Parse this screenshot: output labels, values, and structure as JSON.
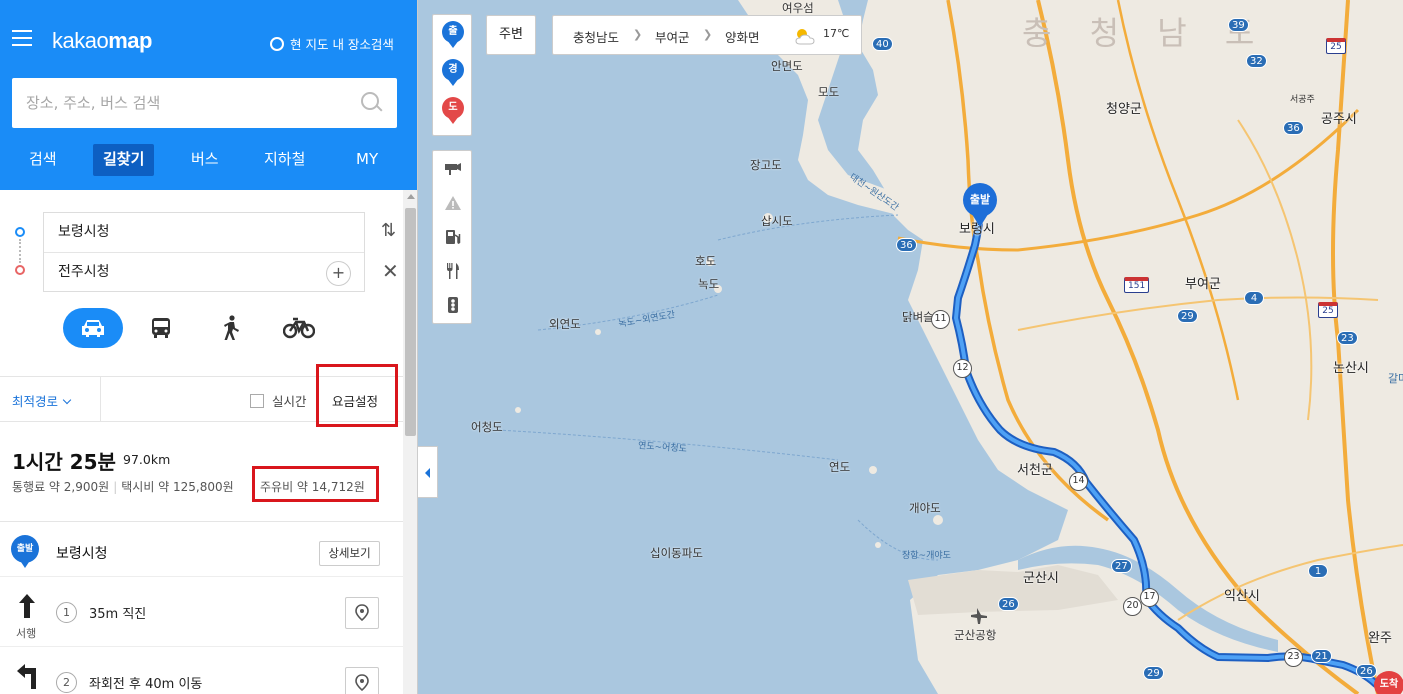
{
  "header": {
    "logo_prefix": "kakao",
    "logo_suffix": "map",
    "area_search_label": "현 지도 내 장소검색",
    "search_placeholder": "장소, 주소, 버스 검색",
    "tabs": [
      "검색",
      "길찾기",
      "버스",
      "지하철",
      "MY"
    ],
    "active_tab": "길찾기"
  },
  "route": {
    "origin": "보령시청",
    "destination": "전주시청",
    "modes": [
      "car",
      "bus",
      "walk",
      "bike"
    ],
    "active_mode": "car",
    "option_label": "최적경로",
    "realtime_label": "실시간",
    "fare_setting_label": "요금설정"
  },
  "summary": {
    "time": "1시간 25분",
    "distance": "97.0km",
    "toll": "통행료 약 2,900원",
    "taxi": "택시비 약 125,800원",
    "fuel": "주유비 약 14,712원"
  },
  "steps": {
    "start_pin": "출발",
    "start_name": "보령시청",
    "detail_button": "상세보기",
    "items": [
      {
        "num": "1",
        "text": "35m 직진",
        "direction": "서행",
        "icon": "arrow-up-icon"
      },
      {
        "num": "2",
        "text": "좌회전 후 40m 이동",
        "direction": "",
        "icon": "turn-left-icon"
      }
    ]
  },
  "map": {
    "pin_tools": [
      "출",
      "경",
      "도"
    ],
    "pin_colors": [
      "#1a73d9",
      "#1a73d9",
      "#e34848"
    ],
    "around_label": "주변",
    "breadcrumb": [
      "충청남도",
      "부여군",
      "양화면"
    ],
    "temperature": "17℃",
    "start_marker": "출발",
    "end_marker": "도착",
    "province_label": "충 청 남 도",
    "places": [
      "여우섬",
      "안면도",
      "모도",
      "장고도",
      "삽시도",
      "호도",
      "녹도",
      "외연도",
      "어청도",
      "연도",
      "개야도",
      "십이동파도",
      "청양군",
      "공주시",
      "보령시",
      "부여군",
      "논산시",
      "닭벼슬섬",
      "서천군",
      "군산시",
      "군산공항",
      "익산시",
      "서공주",
      "완주",
      "갈마"
    ],
    "sea_routes": [
      "녹도~외연도간",
      "연도~어청도",
      "장항~개야도",
      "대천~원산도간"
    ],
    "route_shields": [
      "40",
      "32",
      "39",
      "25",
      "36",
      "36",
      "151",
      "4",
      "29",
      "25",
      "23",
      "11",
      "12",
      "14",
      "27",
      "1",
      "26",
      "20",
      "17",
      "23",
      "21",
      "26",
      "29"
    ]
  },
  "colors": {
    "header_bg": "#1a8cf7",
    "active_tab_bg": "#0d5fc2",
    "route_line": "#2a7be8",
    "highlight_box": "#d9161c",
    "sea": "#aac7df",
    "land": "#eeeae2"
  }
}
